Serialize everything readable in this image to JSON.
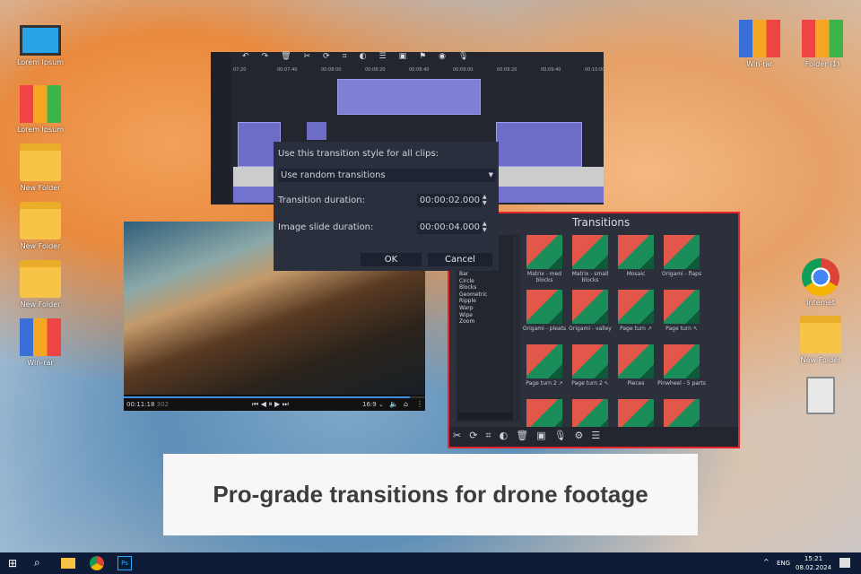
{
  "desktop": {
    "left_icons": [
      {
        "label": "Lorem Ipsum",
        "icon": "computer-icon"
      },
      {
        "label": "Lorem Ipsum",
        "icon": "binders-icon"
      },
      {
        "label": "New Folder",
        "icon": "folder-icon"
      },
      {
        "label": "New Folder",
        "icon": "folder-icon"
      },
      {
        "label": "New Folder",
        "icon": "folder-icon"
      },
      {
        "label": "Win-rar",
        "icon": "winrar-icon"
      }
    ],
    "right_icons": [
      {
        "label": "Win-rar",
        "icon": "winrar-icon"
      },
      {
        "label": "Folder (1)",
        "icon": "binders-icon"
      },
      {
        "label": "Internet",
        "icon": "chrome-icon"
      },
      {
        "label": "New Folder",
        "icon": "folder-icon"
      },
      {
        "label": "",
        "icon": "trash-icon"
      }
    ]
  },
  "timeline": {
    "ticks": [
      "07:20",
      "00:07:40",
      "00:08:00",
      "00:08:20",
      "00:08:40",
      "00:09:00",
      "00:09:20",
      "00:09:40",
      "00:10:00"
    ]
  },
  "dialog": {
    "title": "Use this transition style for all clips:",
    "style_value": "Use random transitions",
    "duration_label": "Transition duration:",
    "duration_value": "00:00:02.000",
    "slide_label": "Image slide duration:",
    "slide_value": "00:00:04.000",
    "ok": "OK",
    "cancel": "Cancel"
  },
  "player": {
    "time": "00:11:18",
    "frames": "302",
    "aspect": "16:9 ⌄",
    "progress": 0.95
  },
  "transitions": {
    "title": "Transitions",
    "categories": [
      "Bar",
      "Circle",
      "Blocks",
      "Geometric",
      "Ripple",
      "Warp",
      "Wipe",
      "Zoom"
    ],
    "items": [
      "Matrix - med blocks",
      "Matrix - small blocks",
      "Mosaic",
      "Origami - flaps",
      "Origami - pleats",
      "Origami - valley",
      "Page turn ↗",
      "Page turn ↖",
      "Page turn 2 ↗",
      "Page turn 2 ↖",
      "Pieces",
      "Pinwheel - 5 parts",
      "",
      "",
      "",
      ""
    ],
    "accent": "#e8232a"
  },
  "caption": "Pro-grade transitions for drone footage",
  "taskbar": {
    "lang": "ENG",
    "time": "15:21",
    "date": "08.02.2024"
  }
}
